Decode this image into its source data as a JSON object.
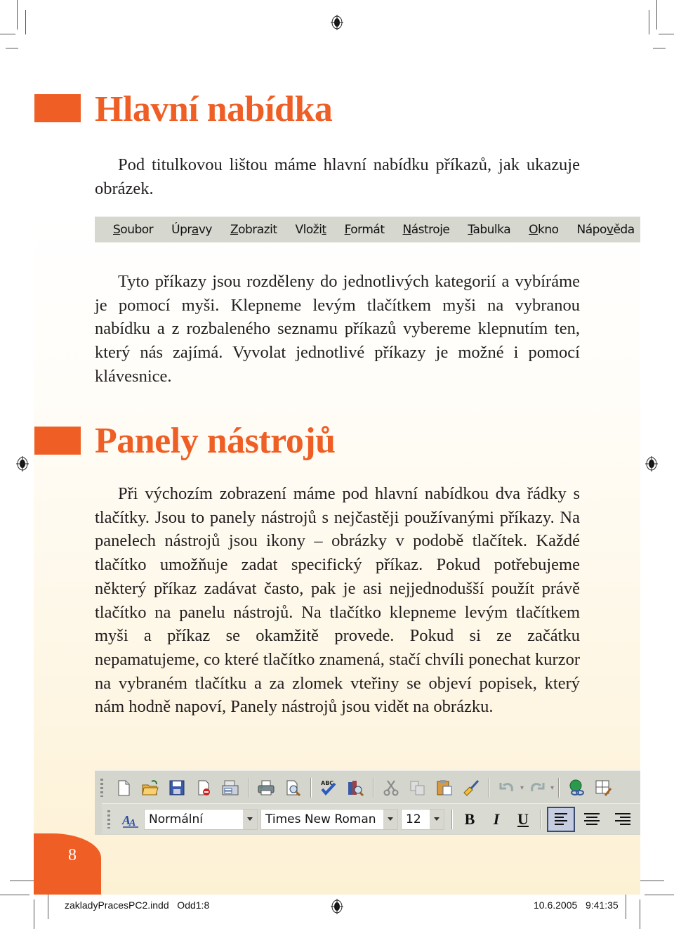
{
  "sections": [
    {
      "title": "Hlavní nabídka",
      "paragraphs": [
        "Pod titulkovou lištou máme hlavní nabídku příkazů, jak ukazuje obrázek.",
        "Tyto příkazy jsou rozděleny do jednotlivých kategorií a vybíráme je pomocí myši. Klepneme levým tlačítkem myši na vybranou nabídku a z rozbaleného seznamu příkazů vybereme klepnutím ten, který nás zajímá. Vyvolat jednotlivé příkazy je možné i pomocí klávesnice."
      ]
    },
    {
      "title": "Panely nástrojů",
      "paragraphs": [
        "Při výchozím zobrazení máme pod hlavní nabídkou dva řádky s tlačítky. Jsou to panely nástrojů s nejčastěji používanými příkazy. Na panelech nástrojů jsou ikony – obrázky v podobě tlačítek. Každé tlačítko umožňuje zadat specifický příkaz. Pokud potřebujeme některý příkaz zadávat často, pak je asi nejjednodušší použít právě tlačítko na panelu nástrojů. Na tlačítko klepneme levým tlačítkem myši a příkaz se okamžitě provede. Pokud si ze začátku nepamatujeme, co které tlačítko znamená, stačí chvíli ponechat kurzor na vybraném tlačítku a za zlomek vteřiny se objeví popisek, který nám hodně napoví, Panely nástrojů jsou vidět na obrázku."
      ]
    }
  ],
  "menubar": {
    "items": [
      {
        "label": "Soubor",
        "accel": "S"
      },
      {
        "label": "Úpravy",
        "accel": "a"
      },
      {
        "label": "Zobrazit",
        "accel": "Z"
      },
      {
        "label": "Vložit",
        "accel": "t"
      },
      {
        "label": "Formát",
        "accel": "F"
      },
      {
        "label": "Nástroje",
        "accel": "N"
      },
      {
        "label": "Tabulka",
        "accel": "T"
      },
      {
        "label": "Okno",
        "accel": "O"
      },
      {
        "label": "Nápověda",
        "accel": "v"
      }
    ]
  },
  "toolbar": {
    "standard_icons": [
      "new-document",
      "open-folder",
      "save",
      "permission",
      "email",
      "print",
      "print-preview",
      "spelling",
      "research",
      "cut",
      "copy",
      "paste",
      "format-painter",
      "undo",
      "redo",
      "hyperlink",
      "tables-borders"
    ],
    "style_value": "Normální",
    "font_value": "Times New Roman",
    "size_value": "12",
    "bold_label": "B",
    "italic_label": "I",
    "underline_label": "U",
    "alignment_active": "left"
  },
  "page_number": "8",
  "slug": {
    "file": "zakladyPracesPC2.indd   Odd1:8",
    "datetime": "10.6.2005   9:41:35"
  },
  "colors": {
    "accent": "#ef5f25",
    "background_cream": "#fdf1d4"
  }
}
